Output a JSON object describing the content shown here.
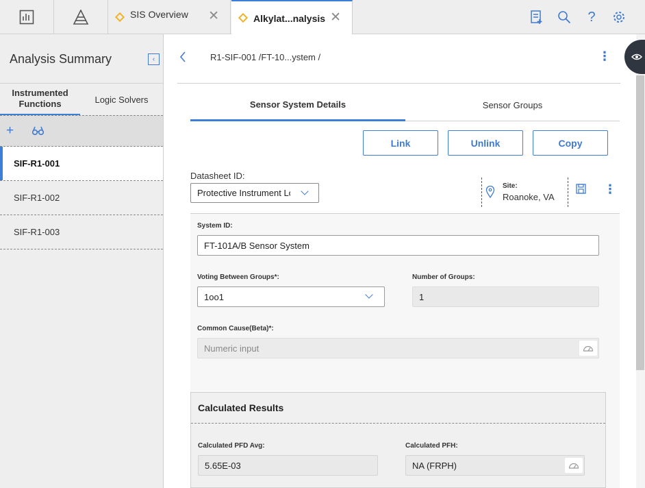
{
  "tabs": [
    {
      "label": "SIS Overview"
    },
    {
      "label": "Alkylat...nalysis"
    }
  ],
  "left_panel": {
    "title": "Analysis Summary",
    "tabs": [
      {
        "label_line1": "Instrumented",
        "label_line2": "Functions"
      },
      {
        "label": "Logic Solvers"
      }
    ],
    "items": [
      {
        "label": "SIF-R1-001"
      },
      {
        "label": "SIF-R1-002"
      },
      {
        "label": "SIF-R1-003"
      }
    ]
  },
  "main": {
    "breadcrumb": "R1-SIF-001 /FT-10...ystem /",
    "subtabs": [
      {
        "label": "Sensor System Details"
      },
      {
        "label": "Sensor Groups"
      }
    ],
    "buttons": {
      "link": "Link",
      "unlink": "Unlink",
      "copy": "Copy"
    },
    "datasheet": {
      "label": "Datasheet ID:",
      "value": "Protective Instrument Loop"
    },
    "site": {
      "label": "Site:",
      "value": "Roanoke, VA"
    },
    "form": {
      "system_id": {
        "label": "System ID:",
        "value": "FT-101A/B Sensor System"
      },
      "voting": {
        "label": "Voting Between Groups*:",
        "value": "1oo1"
      },
      "num_groups": {
        "label": "Number of Groups:",
        "value": "1"
      },
      "common_cause": {
        "label": "Common Cause(Beta)*:",
        "placeholder": "Numeric input"
      }
    },
    "results": {
      "title": "Calculated Results",
      "pfd_avg": {
        "label": "Calculated PFD Avg:",
        "value": "5.65E-03"
      },
      "pfh": {
        "label": "Calculated PFH:",
        "value": "NA (FRPH)"
      }
    }
  },
  "colors": {
    "accent": "#3d7fd6",
    "tab_diamond": "#f0b32c"
  }
}
